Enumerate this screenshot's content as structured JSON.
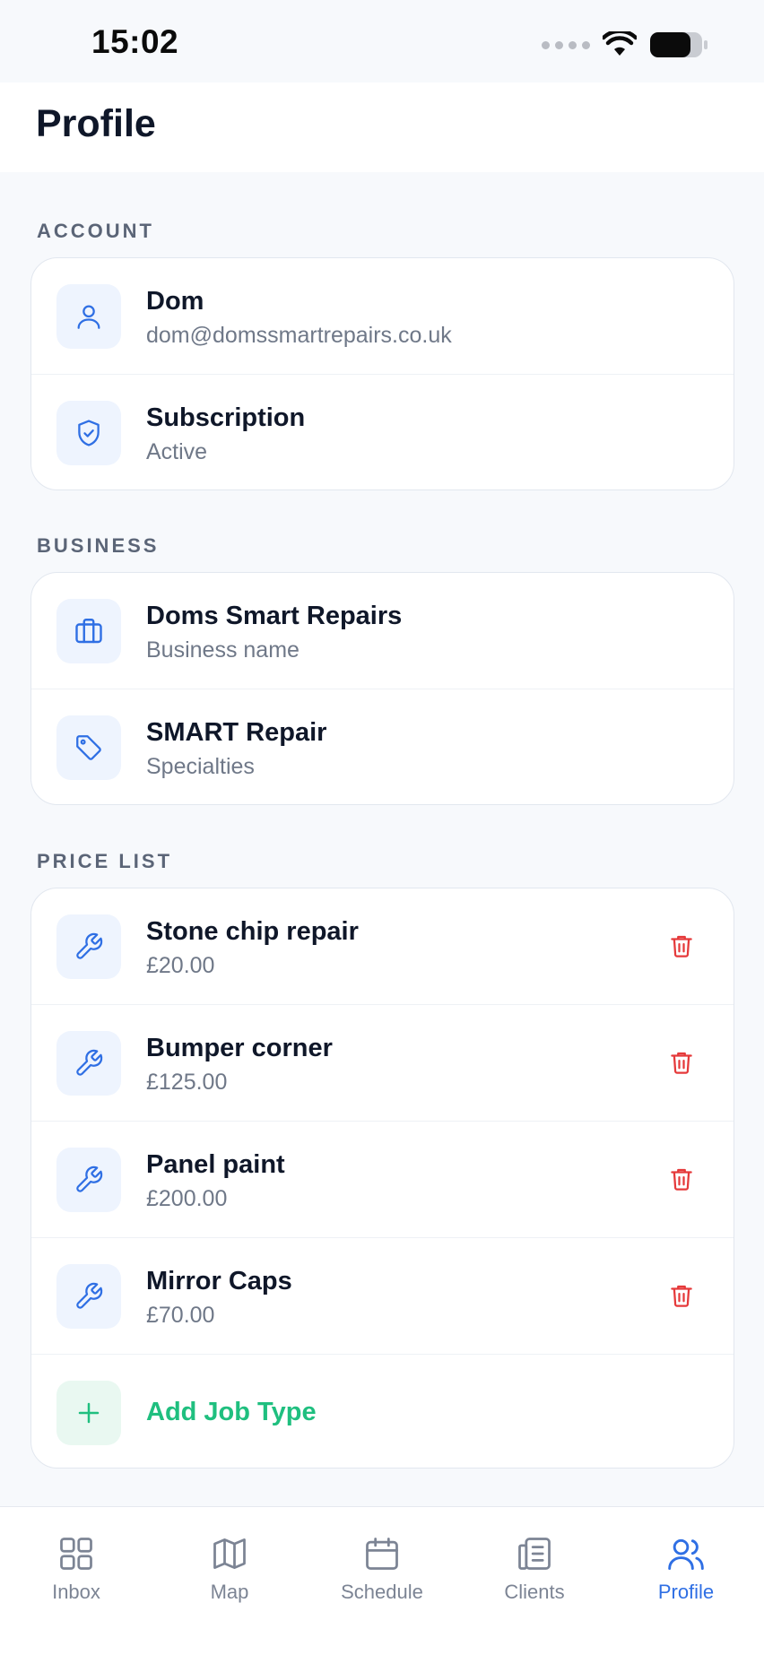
{
  "status_bar": {
    "time": "15:02"
  },
  "header": {
    "title": "Profile"
  },
  "sections": {
    "account": {
      "label": "ACCOUNT",
      "items": [
        {
          "title": "Dom",
          "subtitle": "dom@domssmartrepairs.co.uk",
          "icon": "user-icon"
        },
        {
          "title": "Subscription",
          "subtitle": "Active",
          "icon": "shield-check-icon"
        }
      ]
    },
    "business": {
      "label": "BUSINESS",
      "items": [
        {
          "title": "Doms Smart Repairs",
          "subtitle": "Business name",
          "icon": "briefcase-icon"
        },
        {
          "title": "SMART Repair",
          "subtitle": "Specialties",
          "icon": "tag-icon"
        }
      ]
    },
    "price_list": {
      "label": "PRICE LIST",
      "items": [
        {
          "title": "Stone chip repair",
          "price": "£20.00",
          "icon": "wrench-icon"
        },
        {
          "title": "Bumper corner",
          "price": "£125.00",
          "icon": "wrench-icon"
        },
        {
          "title": "Panel paint",
          "price": "£200.00",
          "icon": "wrench-icon"
        },
        {
          "title": "Mirror Caps",
          "price": "£70.00",
          "icon": "wrench-icon"
        }
      ],
      "add_label": "Add Job Type"
    }
  },
  "tabbar": {
    "tabs": [
      {
        "label": "Inbox",
        "icon": "grid-icon",
        "active": false
      },
      {
        "label": "Map",
        "icon": "map-icon",
        "active": false
      },
      {
        "label": "Schedule",
        "icon": "calendar-icon",
        "active": false
      },
      {
        "label": "Clients",
        "icon": "clipboard-list-icon",
        "active": false
      },
      {
        "label": "Profile",
        "icon": "users-icon",
        "active": true
      }
    ]
  },
  "colors": {
    "accent": "#2f6fe4",
    "success": "#1fbf7f",
    "danger": "#e5393a",
    "background": "#f7f9fc"
  }
}
